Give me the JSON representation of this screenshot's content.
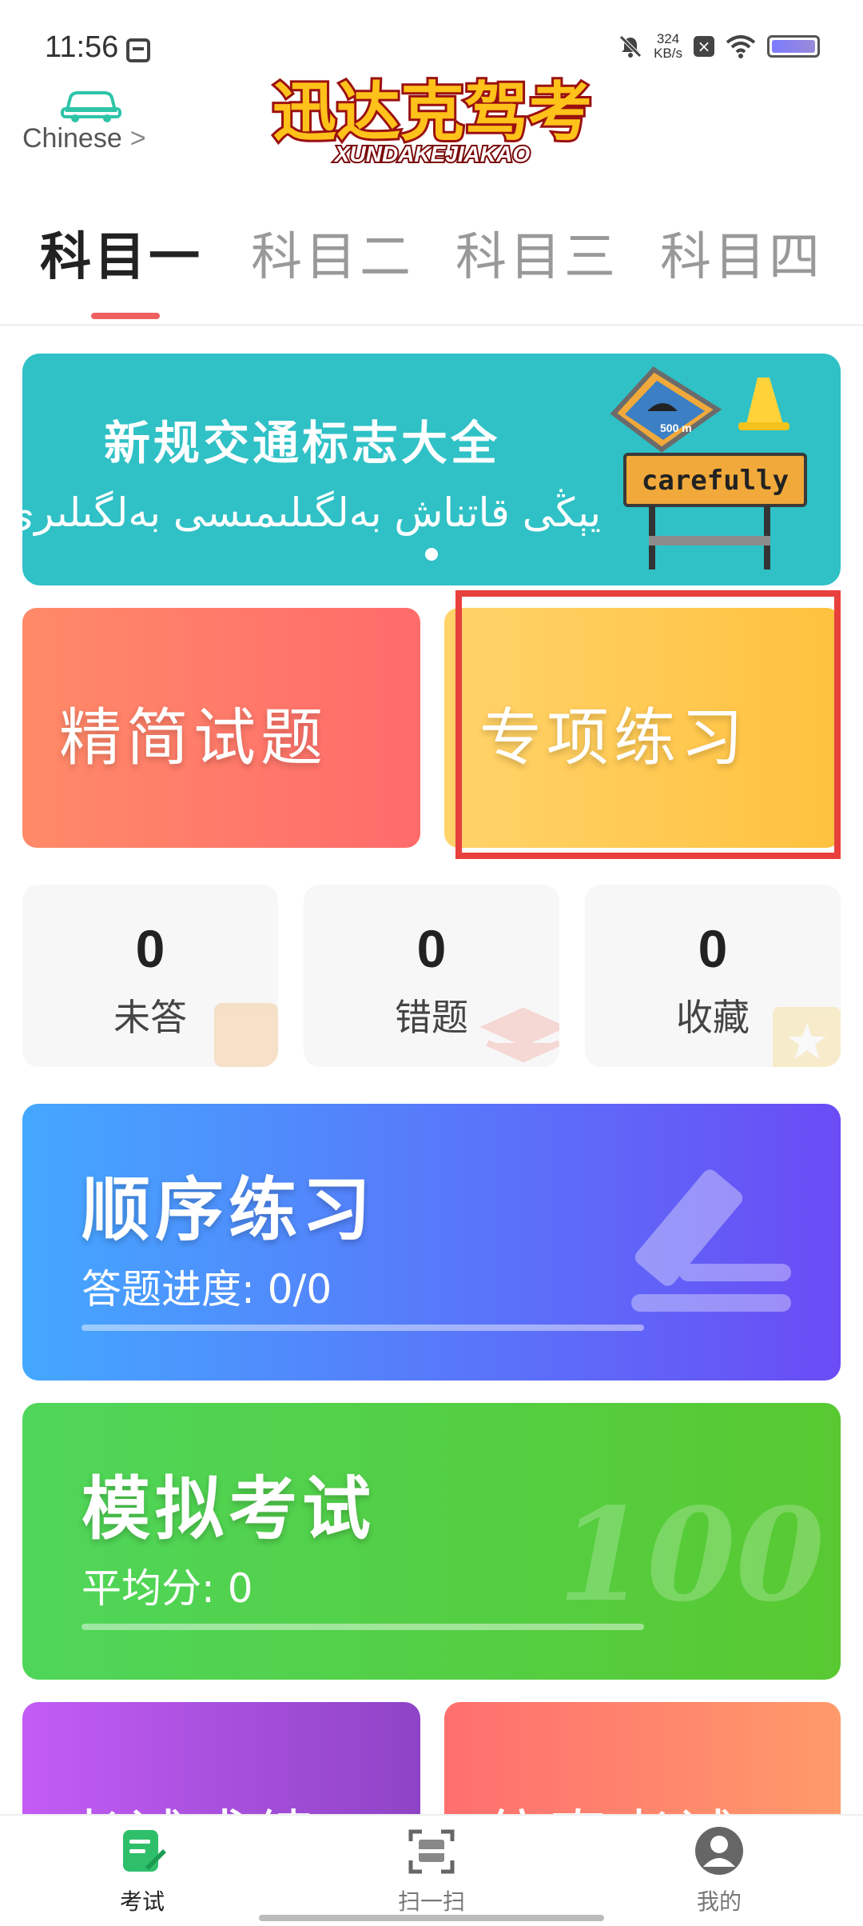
{
  "status_bar": {
    "time": "11:56",
    "net_speed_value": "324",
    "net_speed_unit": "KB/s",
    "icons": [
      "calendar-icon",
      "bell-off-icon",
      "close-box-icon",
      "wifi-icon",
      "battery-icon"
    ]
  },
  "header": {
    "language": "Chinese",
    "lang_chevron": ">",
    "logo_text": "迅达克驾考",
    "logo_subtext": "XUNDAKEJIAKAO"
  },
  "tabs": [
    {
      "label": "科目一",
      "active": true
    },
    {
      "label": "科目二",
      "active": false
    },
    {
      "label": "科目三",
      "active": false
    },
    {
      "label": "科目四",
      "active": false
    }
  ],
  "banner": {
    "title": "新规交通标志大全",
    "subtitle": "يېڭى قاتناش بەلگىلىمىسى بەلگىلىرى",
    "sign_text": "carefully",
    "sign_speed": "500 m",
    "background": "#2fc1c6"
  },
  "cards": {
    "jingjian": "精简试题",
    "zhuanxiang": "专项练习"
  },
  "stats": [
    {
      "value": "0",
      "label": "未答"
    },
    {
      "value": "0",
      "label": "错题"
    },
    {
      "value": "0",
      "label": "收藏"
    }
  ],
  "sequential_practice": {
    "title": "顺序练习",
    "progress_label": "答题进度: 0/0",
    "progress": 0
  },
  "mock_exam": {
    "title": "模拟考试",
    "avg_label": "平均分: 0",
    "deco_text": "100",
    "progress": 0
  },
  "more_cards": {
    "chengji": "考试成绩",
    "fangzhen": "仿真考试"
  },
  "bottom_nav": [
    {
      "label": "考试",
      "icon": "exam-icon",
      "active": true
    },
    {
      "label": "扫一扫",
      "icon": "scan-icon",
      "active": false
    },
    {
      "label": "我的",
      "icon": "profile-icon",
      "active": false
    }
  ],
  "colors": {
    "accent_red": "#f06060",
    "highlight": "#e8403c"
  }
}
